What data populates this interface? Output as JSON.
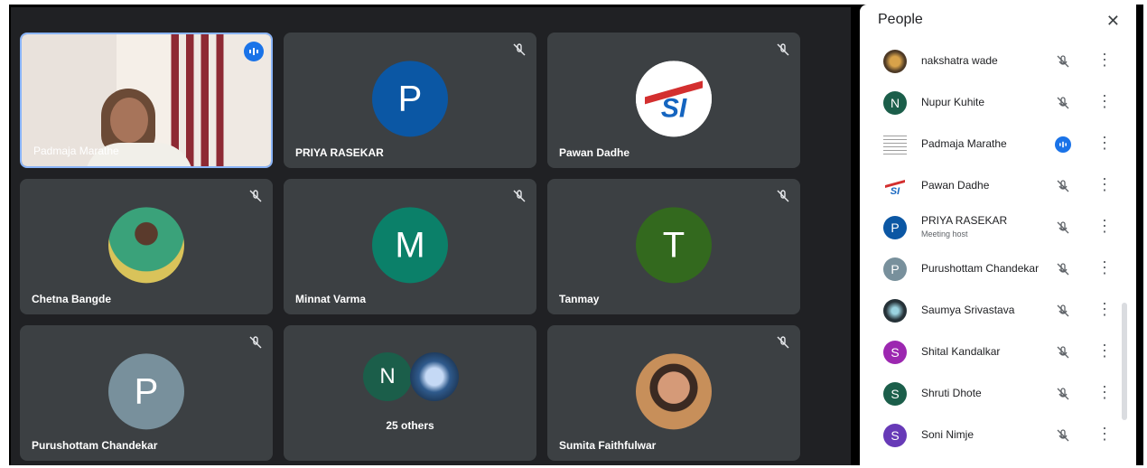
{
  "tiles": [
    {
      "name": "Padmaja Marathe",
      "avatar": "",
      "color": "",
      "speaking": true,
      "video": true
    },
    {
      "name": "PRIYA RASEKAR",
      "avatar": "P",
      "color": "#0b57a4"
    },
    {
      "name": "Pawan Dadhe",
      "avatar": "",
      "color": "#ffffff",
      "logo": true
    },
    {
      "name": "Chetna Bangde",
      "avatar": "",
      "color": "#c06a8e",
      "photo": true
    },
    {
      "name": "Minnat Varma",
      "avatar": "M",
      "color": "#0b8069"
    },
    {
      "name": "Tanmay",
      "avatar": "T",
      "color": "#33691e"
    },
    {
      "name": "Purushottam Chandekar",
      "avatar": "P",
      "color": "#78909c"
    },
    {
      "name": "25 others",
      "avatar": "N",
      "color": "#1b5e4a",
      "others": true
    },
    {
      "name": "Sumita Faithfulwar",
      "avatar": "",
      "color": "#b57a5a",
      "photo": true
    }
  ],
  "panel": {
    "title": "People",
    "close_icon": "✕",
    "people": [
      {
        "name": "nakshatra wade",
        "initial": "",
        "color": "#6d4c2f",
        "speaking": false
      },
      {
        "name": "Nupur Kuhite",
        "initial": "N",
        "color": "#1b5e4a",
        "speaking": false
      },
      {
        "name": "Padmaja Marathe",
        "initial": "",
        "color": "#9e9e9e",
        "speaking": true
      },
      {
        "name": "Pawan Dadhe",
        "initial": "",
        "color": "#c62828",
        "speaking": false
      },
      {
        "name": "PRIYA RASEKAR",
        "subtitle": "Meeting host",
        "initial": "P",
        "color": "#0b57a4",
        "speaking": false
      },
      {
        "name": "Purushottam Chandekar",
        "initial": "P",
        "color": "#78909c",
        "speaking": false
      },
      {
        "name": "Saumya Srivastava",
        "initial": "",
        "color": "#263238",
        "speaking": false
      },
      {
        "name": "Shital Kandalkar",
        "initial": "S",
        "color": "#9c27b0",
        "speaking": false
      },
      {
        "name": "Shruti Dhote",
        "initial": "S",
        "color": "#1b5e4a",
        "speaking": false
      },
      {
        "name": "Soni Nimje",
        "initial": "S",
        "color": "#673ab7",
        "speaking": false
      }
    ]
  }
}
